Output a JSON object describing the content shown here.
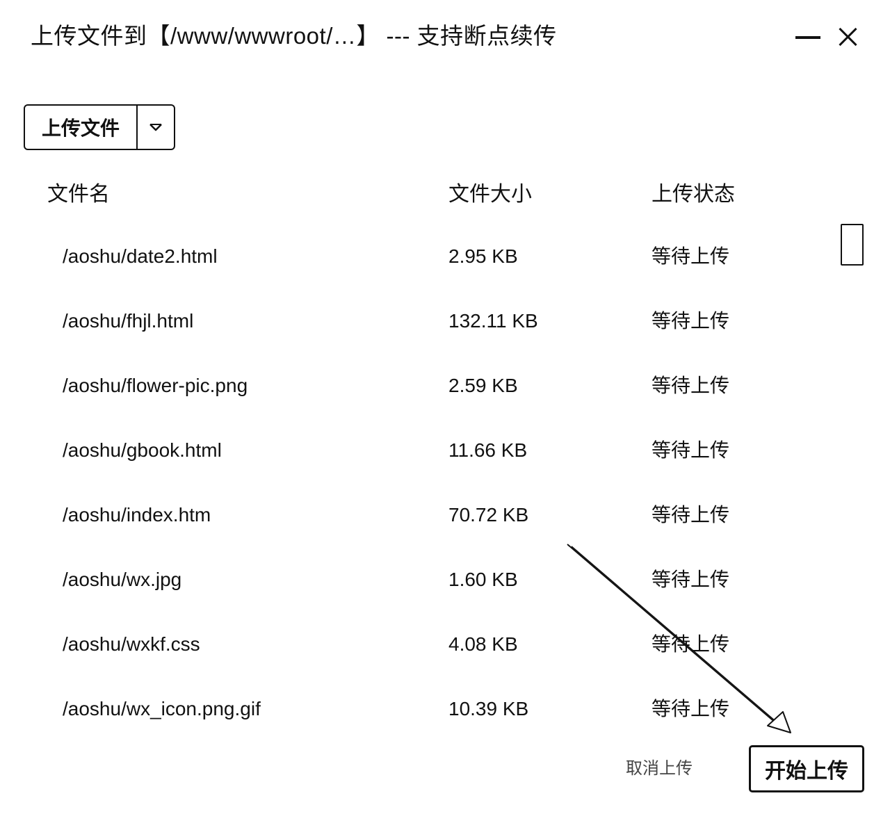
{
  "window": {
    "title": "上传文件到【/www/wwwroot/…】 --- 支持断点续传",
    "minimize_icon": "minimize-icon",
    "close_icon": "close-icon"
  },
  "toolbar": {
    "upload_label": "上传文件",
    "dropdown_icon": "chevron-down-icon"
  },
  "table": {
    "columns": [
      "文件名",
      "文件大小",
      "上传状态"
    ],
    "rows": [
      {
        "name": "/aoshu/date2.html",
        "size": "2.95 KB",
        "status": "等待上传"
      },
      {
        "name": "/aoshu/fhjl.html",
        "size": "132.11 KB",
        "status": "等待上传"
      },
      {
        "name": "/aoshu/flower-pic.png",
        "size": "2.59 KB",
        "status": "等待上传"
      },
      {
        "name": "/aoshu/gbook.html",
        "size": "11.66 KB",
        "status": "等待上传"
      },
      {
        "name": "/aoshu/index.htm",
        "size": "70.72 KB",
        "status": "等待上传"
      },
      {
        "name": "/aoshu/wx.jpg",
        "size": "1.60 KB",
        "status": "等待上传"
      },
      {
        "name": "/aoshu/wxkf.css",
        "size": "4.08 KB",
        "status": "等待上传"
      },
      {
        "name": "/aoshu/wx_icon.png.gif",
        "size": "10.39 KB",
        "status": "等待上传"
      }
    ]
  },
  "footer": {
    "cancel_label": "取消上传",
    "start_label": "开始上传"
  },
  "colors": {
    "text": "#111111",
    "background": "#ffffff",
    "muted": "#444444"
  }
}
